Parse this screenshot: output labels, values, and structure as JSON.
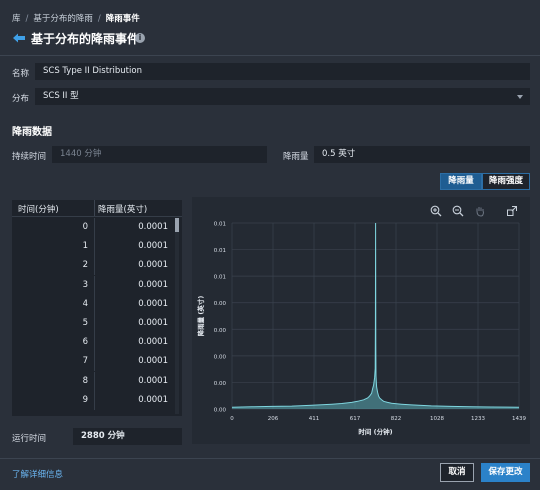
{
  "breadcrumb": {
    "items": [
      "库",
      "基于分布的降雨",
      "降雨事件"
    ]
  },
  "header": {
    "title": "基于分布的降雨事件",
    "info_icon": "info-icon",
    "back_icon": "back-arrow-icon"
  },
  "form": {
    "name_label": "名称",
    "name_value": "SCS Type II Distribution",
    "distribution_label": "分布",
    "distribution_value": "SCS II 型"
  },
  "rain_data": {
    "section_title": "降雨数据",
    "duration_label": "持续时间",
    "duration_placeholder": "1440 分钟",
    "depth_label": "降雨量",
    "depth_value": "0.5 英寸",
    "toggle_depth": "降雨量",
    "toggle_intensity": "降雨强度",
    "toggle_selected": "降雨量"
  },
  "table": {
    "col_time": "时间(分钟)",
    "col_depth": "降雨量(英寸)",
    "rows": [
      {
        "t": "0",
        "v": "0.0001"
      },
      {
        "t": "1",
        "v": "0.0001"
      },
      {
        "t": "2",
        "v": "0.0001"
      },
      {
        "t": "3",
        "v": "0.0001"
      },
      {
        "t": "4",
        "v": "0.0001"
      },
      {
        "t": "5",
        "v": "0.0001"
      },
      {
        "t": "6",
        "v": "0.0001"
      },
      {
        "t": "7",
        "v": "0.0001"
      },
      {
        "t": "8",
        "v": "0.0001"
      },
      {
        "t": "9",
        "v": "0.0001"
      }
    ]
  },
  "run_time": {
    "label": "运行时间",
    "value": "2880 分钟"
  },
  "chart_toolbar": {
    "icons": [
      "zoom-in-icon",
      "zoom-out-icon",
      "pan-icon",
      "expand-icon"
    ]
  },
  "chart_data": {
    "type": "line",
    "xlabel": "时间 (分钟)",
    "ylabel": "降雨量 (英寸)",
    "x_ticks": [
      "0",
      "206",
      "411",
      "617",
      "822",
      "1028",
      "1233",
      "1439"
    ],
    "y_ticks": [
      "0.00",
      "0.00",
      "0.00",
      "0.00",
      "0.00",
      "0.01",
      "0.01",
      "0.01"
    ],
    "xlim": [
      0,
      1439
    ],
    "grid": true,
    "line_color": "#7fd6e0",
    "fill_color": "#5aa9b2",
    "series": [
      {
        "x": [
          0,
          100,
          200,
          300,
          400,
          500,
          550,
          600,
          630,
          660,
          680,
          690,
          700,
          705,
          710,
          715,
          718,
          719,
          720,
          721,
          722,
          725,
          730,
          735,
          740,
          750,
          760,
          780,
          800,
          850,
          900,
          1000,
          1100,
          1200,
          1300,
          1439
        ],
        "y": [
          0.0001,
          0.00012,
          0.00014,
          0.00016,
          0.0002,
          0.00026,
          0.0003,
          0.00036,
          0.00042,
          0.0005,
          0.0006,
          0.0007,
          0.00085,
          0.0011,
          0.0013,
          0.0017,
          0.0022,
          0.0045,
          0.0101,
          0.0036,
          0.0018,
          0.0012,
          0.0009,
          0.0007,
          0.0006,
          0.0005,
          0.00042,
          0.00036,
          0.00031,
          0.00026,
          0.00022,
          0.00017,
          0.00014,
          0.00012,
          0.00011,
          0.0001
        ]
      }
    ]
  },
  "footer": {
    "learn_more": "了解详细信息",
    "cancel": "取消",
    "save": "保存更改"
  },
  "colors": {
    "background": "#2a303a",
    "field": "#1e232b",
    "accent": "#2b82c9",
    "link": "#6bb6f2"
  }
}
